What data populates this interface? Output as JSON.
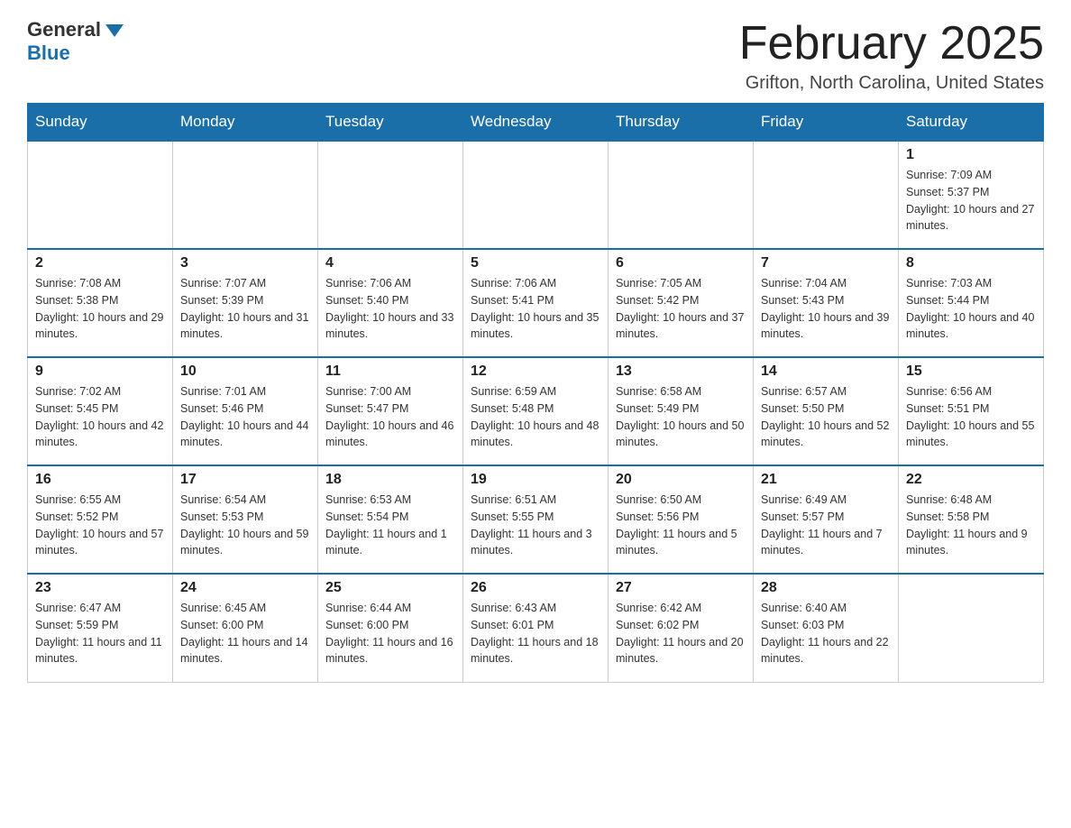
{
  "header": {
    "logo_general": "General",
    "logo_blue": "Blue",
    "month_title": "February 2025",
    "location": "Grifton, North Carolina, United States"
  },
  "days_of_week": [
    "Sunday",
    "Monday",
    "Tuesday",
    "Wednesday",
    "Thursday",
    "Friday",
    "Saturday"
  ],
  "weeks": [
    [
      {
        "day": "",
        "info": ""
      },
      {
        "day": "",
        "info": ""
      },
      {
        "day": "",
        "info": ""
      },
      {
        "day": "",
        "info": ""
      },
      {
        "day": "",
        "info": ""
      },
      {
        "day": "",
        "info": ""
      },
      {
        "day": "1",
        "info": "Sunrise: 7:09 AM\nSunset: 5:37 PM\nDaylight: 10 hours and 27 minutes."
      }
    ],
    [
      {
        "day": "2",
        "info": "Sunrise: 7:08 AM\nSunset: 5:38 PM\nDaylight: 10 hours and 29 minutes."
      },
      {
        "day": "3",
        "info": "Sunrise: 7:07 AM\nSunset: 5:39 PM\nDaylight: 10 hours and 31 minutes."
      },
      {
        "day": "4",
        "info": "Sunrise: 7:06 AM\nSunset: 5:40 PM\nDaylight: 10 hours and 33 minutes."
      },
      {
        "day": "5",
        "info": "Sunrise: 7:06 AM\nSunset: 5:41 PM\nDaylight: 10 hours and 35 minutes."
      },
      {
        "day": "6",
        "info": "Sunrise: 7:05 AM\nSunset: 5:42 PM\nDaylight: 10 hours and 37 minutes."
      },
      {
        "day": "7",
        "info": "Sunrise: 7:04 AM\nSunset: 5:43 PM\nDaylight: 10 hours and 39 minutes."
      },
      {
        "day": "8",
        "info": "Sunrise: 7:03 AM\nSunset: 5:44 PM\nDaylight: 10 hours and 40 minutes."
      }
    ],
    [
      {
        "day": "9",
        "info": "Sunrise: 7:02 AM\nSunset: 5:45 PM\nDaylight: 10 hours and 42 minutes."
      },
      {
        "day": "10",
        "info": "Sunrise: 7:01 AM\nSunset: 5:46 PM\nDaylight: 10 hours and 44 minutes."
      },
      {
        "day": "11",
        "info": "Sunrise: 7:00 AM\nSunset: 5:47 PM\nDaylight: 10 hours and 46 minutes."
      },
      {
        "day": "12",
        "info": "Sunrise: 6:59 AM\nSunset: 5:48 PM\nDaylight: 10 hours and 48 minutes."
      },
      {
        "day": "13",
        "info": "Sunrise: 6:58 AM\nSunset: 5:49 PM\nDaylight: 10 hours and 50 minutes."
      },
      {
        "day": "14",
        "info": "Sunrise: 6:57 AM\nSunset: 5:50 PM\nDaylight: 10 hours and 52 minutes."
      },
      {
        "day": "15",
        "info": "Sunrise: 6:56 AM\nSunset: 5:51 PM\nDaylight: 10 hours and 55 minutes."
      }
    ],
    [
      {
        "day": "16",
        "info": "Sunrise: 6:55 AM\nSunset: 5:52 PM\nDaylight: 10 hours and 57 minutes."
      },
      {
        "day": "17",
        "info": "Sunrise: 6:54 AM\nSunset: 5:53 PM\nDaylight: 10 hours and 59 minutes."
      },
      {
        "day": "18",
        "info": "Sunrise: 6:53 AM\nSunset: 5:54 PM\nDaylight: 11 hours and 1 minute."
      },
      {
        "day": "19",
        "info": "Sunrise: 6:51 AM\nSunset: 5:55 PM\nDaylight: 11 hours and 3 minutes."
      },
      {
        "day": "20",
        "info": "Sunrise: 6:50 AM\nSunset: 5:56 PM\nDaylight: 11 hours and 5 minutes."
      },
      {
        "day": "21",
        "info": "Sunrise: 6:49 AM\nSunset: 5:57 PM\nDaylight: 11 hours and 7 minutes."
      },
      {
        "day": "22",
        "info": "Sunrise: 6:48 AM\nSunset: 5:58 PM\nDaylight: 11 hours and 9 minutes."
      }
    ],
    [
      {
        "day": "23",
        "info": "Sunrise: 6:47 AM\nSunset: 5:59 PM\nDaylight: 11 hours and 11 minutes."
      },
      {
        "day": "24",
        "info": "Sunrise: 6:45 AM\nSunset: 6:00 PM\nDaylight: 11 hours and 14 minutes."
      },
      {
        "day": "25",
        "info": "Sunrise: 6:44 AM\nSunset: 6:00 PM\nDaylight: 11 hours and 16 minutes."
      },
      {
        "day": "26",
        "info": "Sunrise: 6:43 AM\nSunset: 6:01 PM\nDaylight: 11 hours and 18 minutes."
      },
      {
        "day": "27",
        "info": "Sunrise: 6:42 AM\nSunset: 6:02 PM\nDaylight: 11 hours and 20 minutes."
      },
      {
        "day": "28",
        "info": "Sunrise: 6:40 AM\nSunset: 6:03 PM\nDaylight: 11 hours and 22 minutes."
      },
      {
        "day": "",
        "info": ""
      }
    ]
  ]
}
